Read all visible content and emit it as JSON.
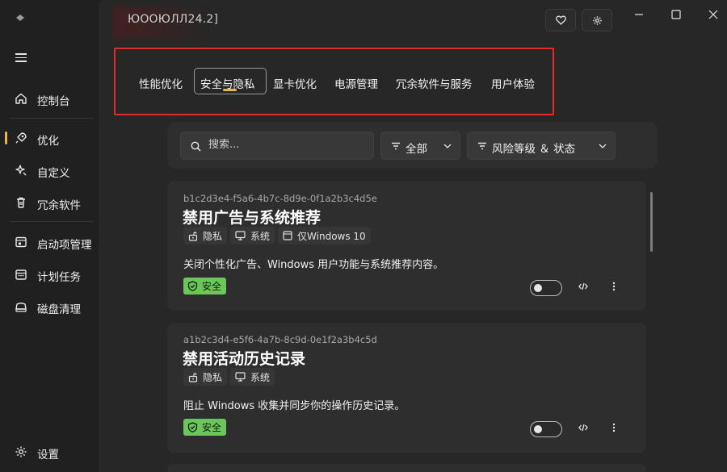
{
  "window": {
    "title": "ЮООЮЛЛ24.2]",
    "buttons": {
      "favorite": "heart-icon",
      "settings": "gear-icon"
    }
  },
  "sidebar": {
    "items": [
      {
        "label": "控制台",
        "icon": "home-icon"
      },
      {
        "label": "优化",
        "icon": "rocket-icon",
        "active": true
      },
      {
        "label": "自定义",
        "icon": "customize-icon"
      },
      {
        "label": "冗余软件",
        "icon": "trash-icon"
      },
      {
        "label": "启动项管理",
        "icon": "startup-icon"
      },
      {
        "label": "计划任务",
        "icon": "calendar-icon"
      },
      {
        "label": "磁盘清理",
        "icon": "disk-icon"
      }
    ],
    "settings_label": "设置"
  },
  "tabs": {
    "items": [
      "性能优化",
      "安全与隐私",
      "显卡优化",
      "电源管理",
      "冗余软件与服务",
      "用户体验"
    ],
    "active_index": 1
  },
  "filters": {
    "search_placeholder": "搜索...",
    "category_label": "全部",
    "risk_label": "风险等级 ＆ 状态"
  },
  "cards": [
    {
      "id": "b1c2d3e4-f5a6-4b7c-8d9e-0f1a2b3c4d5e",
      "title": "禁用广告与系统推荐",
      "tags": [
        "隐私",
        "系统",
        "仅Windows 10"
      ],
      "description": "关闭个性化广告、Windows 用户功能与系统推荐内容。",
      "risk": "安全",
      "enabled": false
    },
    {
      "id": "a1b2c3d4-e5f6-4a7b-8c9d-0e1f2a3b4c5d",
      "title": "禁用活动历史记录",
      "tags": [
        "隐私",
        "系统"
      ],
      "description": "阻止 Windows 收集并同步你的操作历史记录。",
      "risk": "安全",
      "enabled": false
    }
  ],
  "colors": {
    "accent": "#e8b84a",
    "safe": "#6cc75a",
    "highlight": "#e32b2b"
  }
}
